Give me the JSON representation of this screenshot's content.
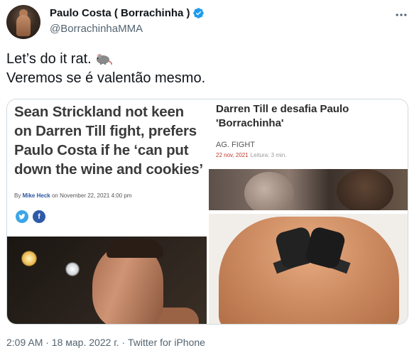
{
  "author": {
    "display_name": "Paulo Costa ( Borrachinha )",
    "handle": "@BorrachinhaMMA"
  },
  "tweet": {
    "line1": "Let’s do it rat.",
    "line2": "Veremos se é valentão mesmo."
  },
  "media_left": {
    "headline": "Sean Strickland not keen on Darren Till fight, prefers Paulo Costa if he ‘can put down the wine and cookies’",
    "byline_prefix": "By",
    "byline_author": "Mike Heck",
    "byline_date": "on November 22, 2021 4:00 pm"
  },
  "media_right": {
    "title": "Darren Till e desafia Paulo 'Borrachinha'",
    "category": "AG. FIGHT",
    "date": "22 nov, 2021",
    "read_time": "Leitura: 3 min."
  },
  "meta": {
    "timestamp": "2:09 AM · 18 мар. 2022 г. · Twitter for iPhone"
  },
  "colors": {
    "verified": "#1d9bf0",
    "secondary_text": "#536471"
  }
}
